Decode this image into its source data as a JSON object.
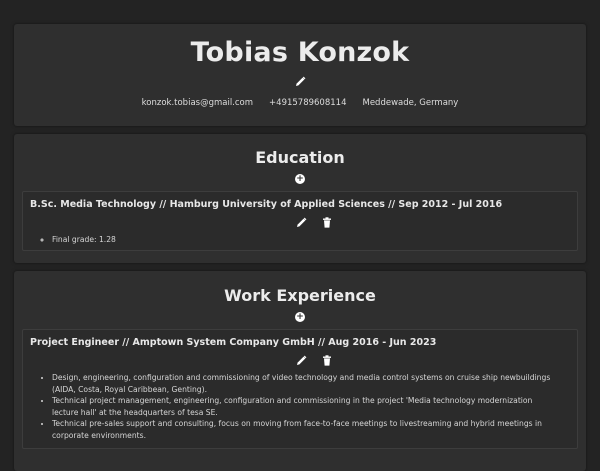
{
  "profile": {
    "name": "Tobias Konzok",
    "email": "konzok.tobias@gmail.com",
    "phone": "+4915789608114",
    "location": "Meddewade, Germany",
    "edit_icon": "pencil-icon"
  },
  "education": {
    "title": "Education",
    "add_icon": "plus-circle-icon",
    "entries": [
      {
        "title": "B.Sc. Media Technology // Hamburg University of Applied Sciences // Sep 2012 - Jul 2016",
        "bullets": [
          "Final grade: 1.28"
        ]
      }
    ]
  },
  "work": {
    "title": "Work Experience",
    "add_icon": "plus-circle-icon",
    "entries": [
      {
        "title": "Project Engineer // Amptown System Company GmbH // Aug 2016 - Jun 2023",
        "bullets": [
          "Design, engineering, configuration and commissioning of video technology and media control systems on cruise ship newbuildings (AIDA, Costa, Royal Caribbean, Genting).",
          "Technical project management, engineering, configuration and commissioning in the project 'Media technology modernization lecture hall' at the headquarters of tesa SE.",
          "Technical pre-sales support and consulting, focus on moving from face-to-face meetings to livestreaming and hybrid meetings in corporate environments."
        ]
      }
    ]
  }
}
